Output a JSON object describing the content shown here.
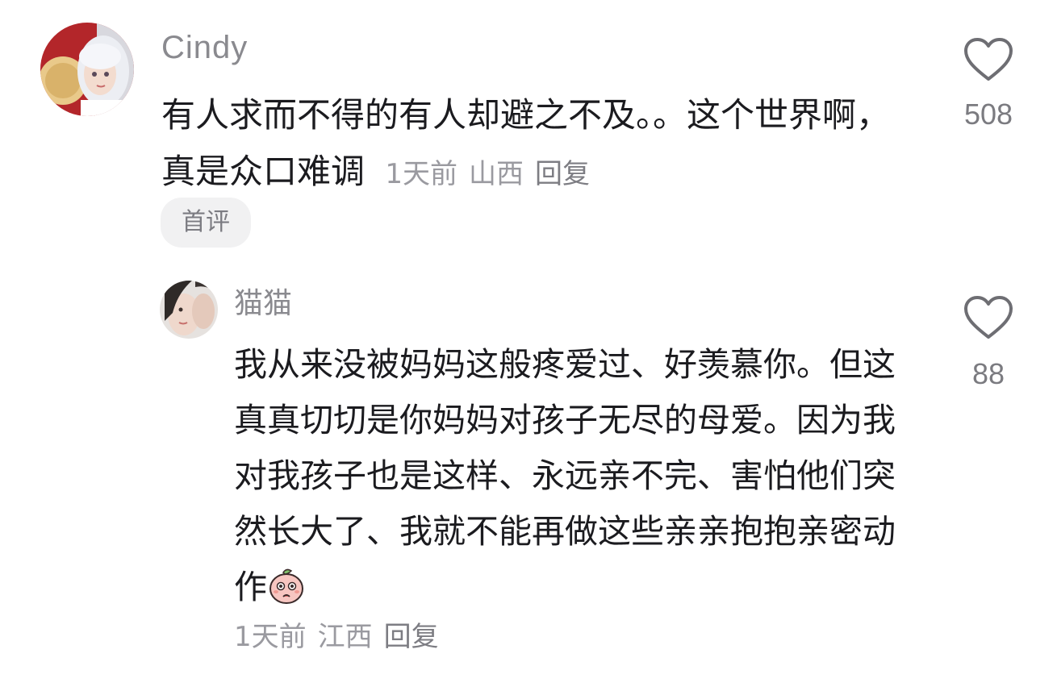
{
  "comments": [
    {
      "username": "Cindy",
      "text": "有人求而不得的有人却避之不及。。这个世界啊，真是众口难调",
      "time": "1天前",
      "location": "山西",
      "reply_label": "回复",
      "tag": "首评",
      "like_count": "508",
      "avatar_icon": "anime-avatar-icon",
      "like_icon": "heart-outline-icon"
    },
    {
      "username": "猫猫",
      "text": "我从来没被妈妈这般疼爱过、好羡慕你。但这真真切切是你妈妈对孩子无尽的母爱。因为我对我孩子也是这样、永远亲不完、害怕他们突然长大了、我就不能再做这些亲亲抱抱亲密动作",
      "emoji": "shy-peach-emoji",
      "time": "1天前",
      "location": "江西",
      "reply_label": "回复",
      "like_count": "88",
      "avatar_icon": "photo-avatar-icon",
      "like_icon": "heart-outline-icon"
    }
  ],
  "colors": {
    "username": "#8a8a8f",
    "text": "#1b1b1f",
    "meta": "#9a9aa0",
    "tag_bg": "#f1f1f2",
    "heart_stroke": "#6e6e73"
  }
}
